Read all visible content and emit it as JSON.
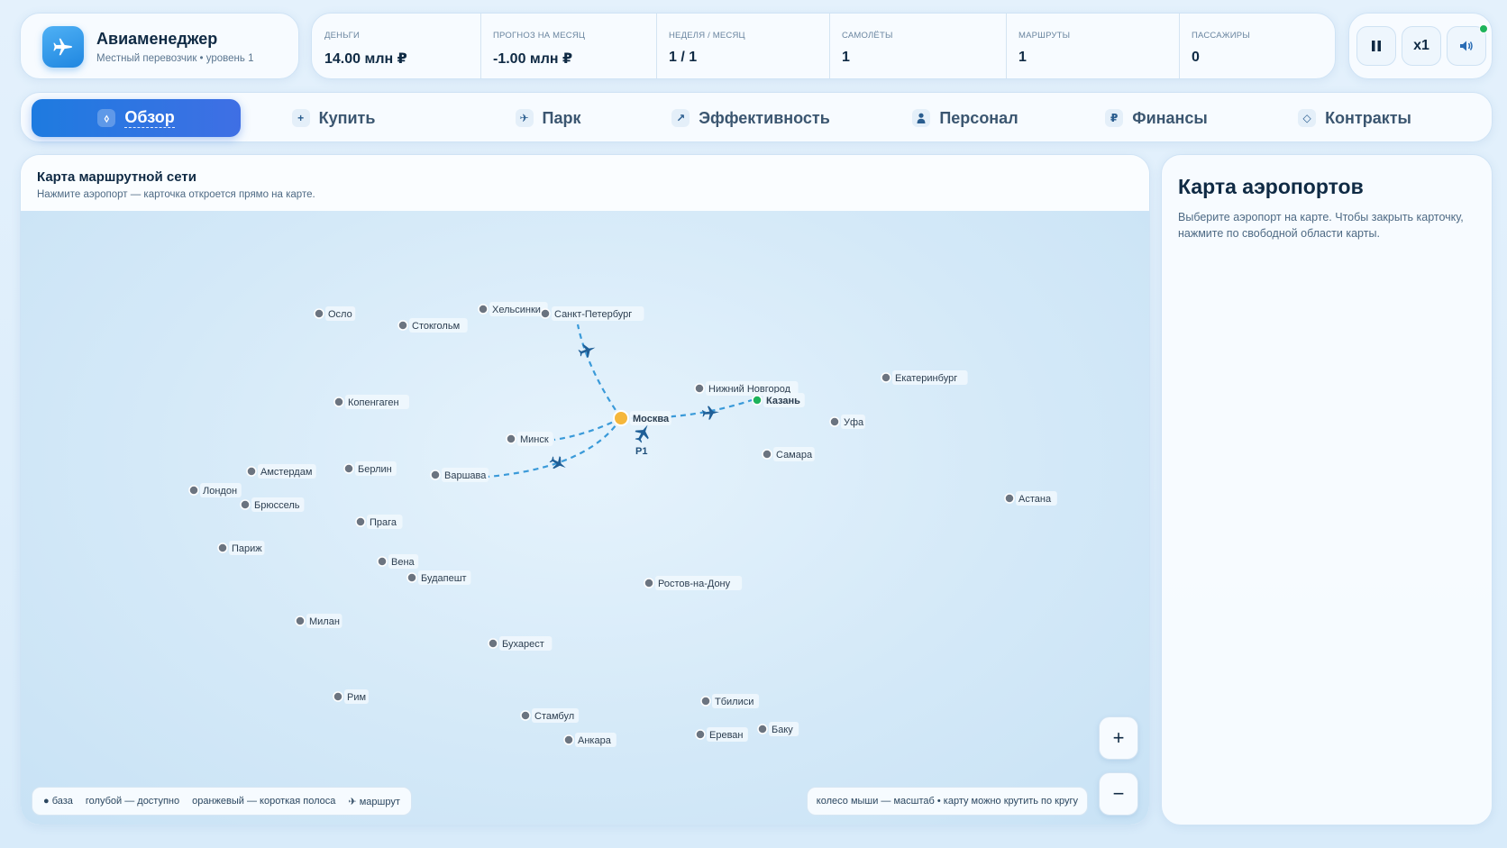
{
  "brand": {
    "title": "Авиаменеджер",
    "subtitle": "Местный перевозчик • уровень 1",
    "logo_icon": "airplane-icon"
  },
  "stats": [
    {
      "label": "Деньги",
      "value": "14.00 млн ₽"
    },
    {
      "label": "Прогноз на месяц",
      "value": "-1.00 млн ₽"
    },
    {
      "label": "Неделя / месяц",
      "value": "1 / 1"
    },
    {
      "label": "Самолёты",
      "value": "1"
    },
    {
      "label": "Маршруты",
      "value": "1"
    },
    {
      "label": "Пассажиры",
      "value": "0"
    }
  ],
  "controls": {
    "pause_icon": "pause-icon",
    "speed": "x1",
    "sound_icon": "speaker-icon"
  },
  "tabs": [
    {
      "label": "Обзор",
      "icon": "overview-icon",
      "glyph": "⬨",
      "active": true
    },
    {
      "label": "Купить",
      "icon": "plus-icon",
      "glyph": "+"
    },
    {
      "label": "Парк",
      "icon": "plane-icon",
      "glyph": "✈"
    },
    {
      "label": "Эффективность",
      "icon": "trend-icon",
      "glyph": "↗"
    },
    {
      "label": "Персонал",
      "icon": "person-icon",
      "glyph": "👤"
    },
    {
      "label": "Финансы",
      "icon": "ruble-icon",
      "glyph": "₽"
    },
    {
      "label": "Контракты",
      "icon": "diamond-icon",
      "glyph": "◇"
    }
  ],
  "map": {
    "title": "Карта маршрутной сети",
    "subtitle": "Нажмите аэропорт — карточка откроется прямо на карте.",
    "plane_label": "P1",
    "legend": {
      "base": "база",
      "blue": "голубой — доступно",
      "orange": "оранжевый — короткая полоса",
      "route": "маршрут"
    },
    "hint": "колесо мыши — масштаб • карту можно крутить по кругу",
    "zoom_in": "+",
    "zoom_out": "−",
    "airports": [
      {
        "name": "Осло",
        "status": "available"
      },
      {
        "name": "Стокгольм",
        "status": "available"
      },
      {
        "name": "Хельсинки",
        "status": "available"
      },
      {
        "name": "Санкт-Петербург",
        "status": "available"
      },
      {
        "name": "Копенгаген",
        "status": "available"
      },
      {
        "name": "Нижний Новгород",
        "status": "available"
      },
      {
        "name": "Казань",
        "status": "connected"
      },
      {
        "name": "Екатеринбург",
        "status": "available"
      },
      {
        "name": "Москва",
        "status": "base"
      },
      {
        "name": "Минск",
        "status": "available"
      },
      {
        "name": "Уфа",
        "status": "available"
      },
      {
        "name": "Самара",
        "status": "available"
      },
      {
        "name": "Амстердам",
        "status": "available"
      },
      {
        "name": "Берлин",
        "status": "available"
      },
      {
        "name": "Варшава",
        "status": "available"
      },
      {
        "name": "Лондон",
        "status": "available"
      },
      {
        "name": "Брюссель",
        "status": "available"
      },
      {
        "name": "Прага",
        "status": "available"
      },
      {
        "name": "Астана",
        "status": "available"
      },
      {
        "name": "Париж",
        "status": "available"
      },
      {
        "name": "Вена",
        "status": "available"
      },
      {
        "name": "Будапешт",
        "status": "available"
      },
      {
        "name": "Ростов-на-Дону",
        "status": "available"
      },
      {
        "name": "Милан",
        "status": "available"
      },
      {
        "name": "Бухарест",
        "status": "available"
      },
      {
        "name": "Рим",
        "status": "available"
      },
      {
        "name": "Тбилиси",
        "status": "available"
      },
      {
        "name": "Стамбул",
        "status": "available"
      },
      {
        "name": "Баку",
        "status": "available"
      },
      {
        "name": "Ереван",
        "status": "available"
      },
      {
        "name": "Анкара",
        "status": "available"
      }
    ]
  },
  "side": {
    "title": "Карта аэропортов",
    "text": "Выберите аэропорт на карте. Чтобы закрыть карточку, нажмите по свободной области карты."
  },
  "colors": {
    "accent": "#1e7be0",
    "route": "#3a9ad9",
    "base": "#f5b73b",
    "connected": "#1eb35b",
    "available": "#6b7480"
  }
}
